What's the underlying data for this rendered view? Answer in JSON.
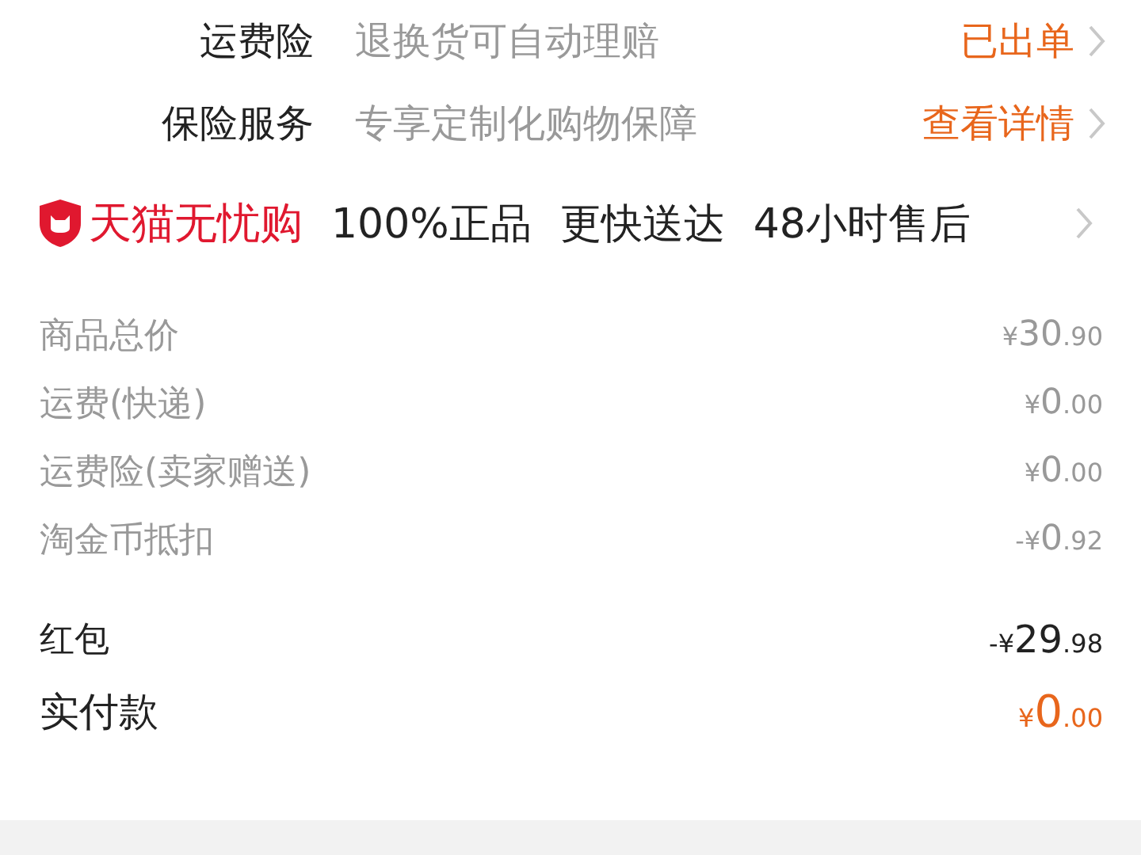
{
  "services": [
    {
      "label": "运费险",
      "description": "退换货可自动理赔",
      "action": "已出单"
    },
    {
      "label": "保险服务",
      "description": "专享定制化购物保障",
      "action": "查看详情"
    }
  ],
  "guarantee": {
    "brand": "天猫无忧购",
    "features": [
      "100%正品",
      "更快送达",
      "48小时售后"
    ]
  },
  "fees": [
    {
      "kind": "muted",
      "label": "商品总价",
      "amount": {
        "symbol": "¥",
        "integer": "30",
        "decimal": ".90"
      }
    },
    {
      "kind": "muted",
      "label": "运费(快递)",
      "amount": {
        "symbol": "¥",
        "integer": "0",
        "decimal": ".00"
      }
    },
    {
      "kind": "muted",
      "label": "运费险(卖家赠送)",
      "amount": {
        "symbol": "¥",
        "integer": "0",
        "decimal": ".00"
      }
    },
    {
      "kind": "muted",
      "label": "淘金币抵扣",
      "amount": {
        "symbol": "-¥",
        "integer": "0",
        "decimal": ".92"
      }
    },
    {
      "kind": "emphasis",
      "label": "红包",
      "amount": {
        "symbol": "-¥",
        "integer": "29",
        "decimal": ".98"
      }
    },
    {
      "kind": "total",
      "label": "实付款",
      "amount": {
        "symbol": "¥",
        "integer": "0",
        "decimal": ".00"
      }
    }
  ]
}
